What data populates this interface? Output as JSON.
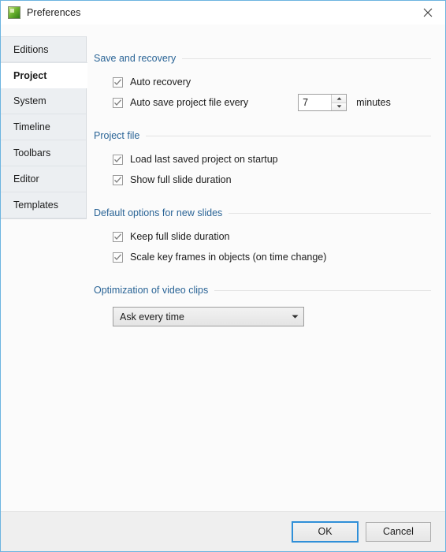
{
  "window": {
    "title": "Preferences",
    "app_icon": "app-green-icon",
    "close_icon": "close-icon",
    "accent_border": "#6cb4e0",
    "section_title_color": "#2a6496"
  },
  "sidebar": {
    "items": [
      {
        "label": "Editions",
        "selected": false
      },
      {
        "label": "Project",
        "selected": true
      },
      {
        "label": "System",
        "selected": false
      },
      {
        "label": "Timeline",
        "selected": false
      },
      {
        "label": "Toolbars",
        "selected": false
      },
      {
        "label": "Editor",
        "selected": false
      },
      {
        "label": "Templates",
        "selected": false
      }
    ]
  },
  "groups": {
    "save_and_recovery": {
      "title": "Save and recovery",
      "auto_recovery": {
        "label": "Auto recovery",
        "checked": true
      },
      "auto_save": {
        "label": "Auto save project file every",
        "checked": true
      },
      "interval": {
        "value": "7",
        "unit": "minutes"
      }
    },
    "project_file": {
      "title": "Project file",
      "load_last": {
        "label": "Load last saved project on startup",
        "checked": true
      },
      "show_full": {
        "label": "Show full slide duration",
        "checked": true
      }
    },
    "default_options": {
      "title": "Default options for new slides",
      "keep_full": {
        "label": "Keep full slide duration",
        "checked": true
      },
      "scale_keyframes": {
        "label": "Scale key frames in objects (on time change)",
        "checked": true
      }
    },
    "optimization": {
      "title": "Optimization of video clips",
      "selected_option": "Ask every time"
    }
  },
  "footer": {
    "ok_label": "OK",
    "cancel_label": "Cancel"
  }
}
